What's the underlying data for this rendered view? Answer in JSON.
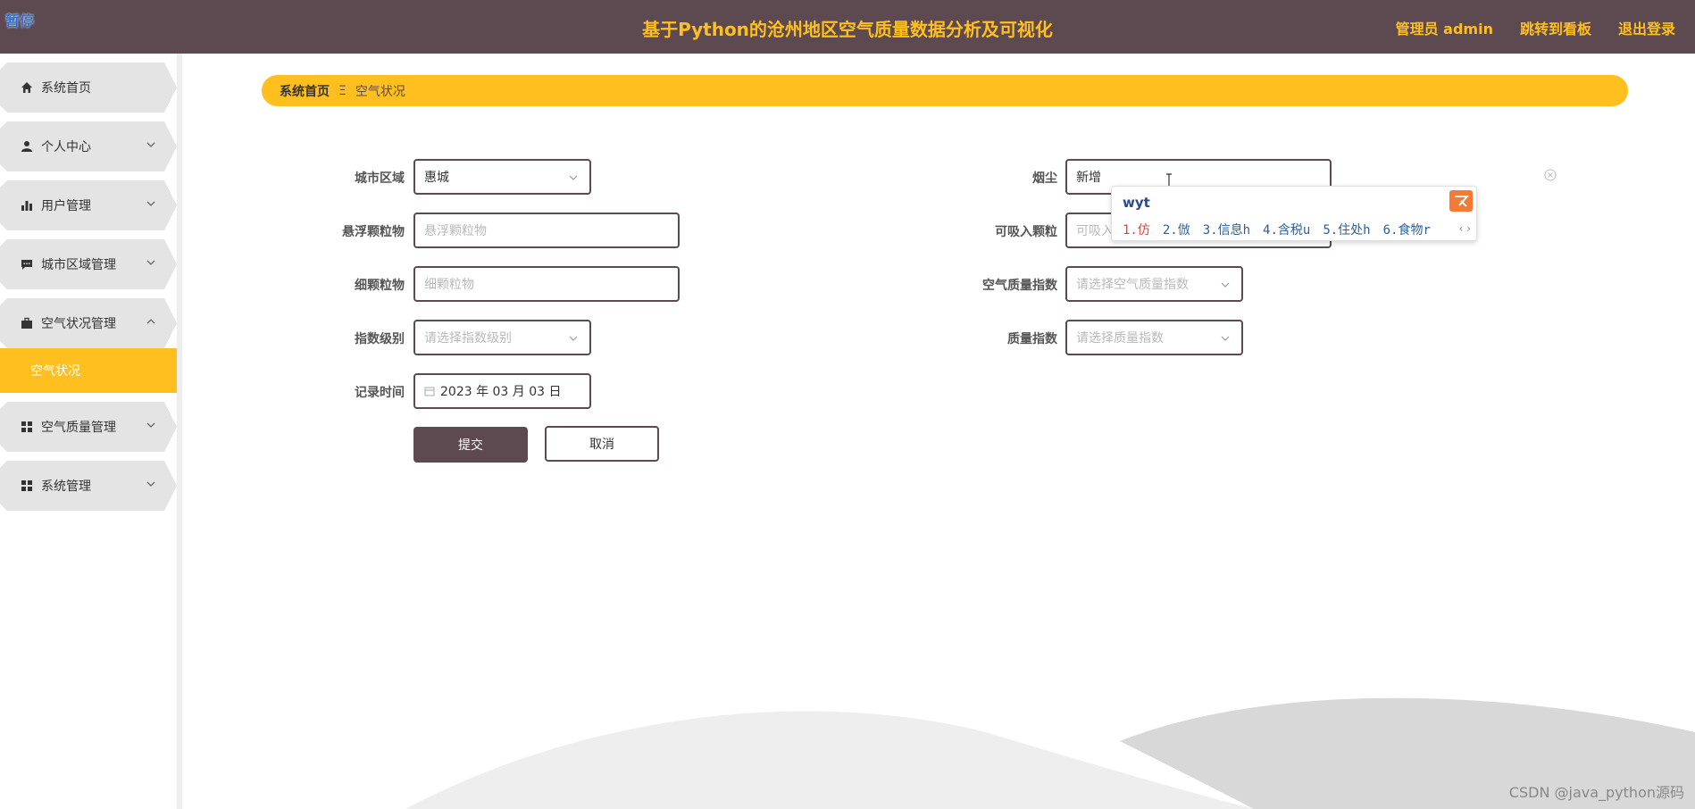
{
  "header": {
    "pause_label": "暂停",
    "title": "基于Python的沧州地区空气质量数据分析及可视化",
    "links": [
      "管理员 admin",
      "跳转到看板",
      "退出登录"
    ]
  },
  "sidebar": {
    "items": [
      {
        "label": "系统首页",
        "icon": "home-icon"
      },
      {
        "label": "个人中心",
        "icon": "user-icon"
      },
      {
        "label": "用户管理",
        "icon": "bar-chart-icon"
      },
      {
        "label": "城市区域管理",
        "icon": "chat-icon"
      },
      {
        "label": "空气状况管理",
        "icon": "briefcase-icon"
      },
      {
        "label": "空气质量管理",
        "icon": "grid-icon"
      },
      {
        "label": "系统管理",
        "icon": "grid-icon"
      }
    ],
    "active_sub": "空气状况"
  },
  "breadcrumb": {
    "home": "系统首页",
    "separator": "Ξ",
    "current": "空气状况"
  },
  "form": {
    "city_label": "城市区域",
    "city_value": "惠城",
    "dust_label": "烟尘",
    "dust_value": "新增",
    "tsp_label": "悬浮颗粒物",
    "tsp_placeholder": "悬浮颗粒物",
    "pm10_label": "可吸入颗粒",
    "pm10_placeholder": "可吸入",
    "pm25_label": "细颗粒物",
    "pm25_placeholder": "细颗粒物",
    "aqi_label": "空气质量指数",
    "aqi_placeholder": "请选择空气质量指数",
    "level_label": "指数级别",
    "level_placeholder": "请选择指数级别",
    "quality_label": "质量指数",
    "quality_placeholder": "请选择质量指数",
    "time_label": "记录时间",
    "time_value": "2023 年 03 月 03 日",
    "submit_label": "提交",
    "cancel_label": "取消"
  },
  "ime": {
    "typed": "wyt",
    "candidates": [
      "1.仿",
      "2.倣",
      "3.信息h",
      "4.含税u",
      "5.住处h",
      "6.食物r"
    ],
    "nav": "‹ ›"
  },
  "watermark": "CSDN @java_python源码",
  "colors": {
    "header_bg": "#5d4a51",
    "accent": "#ffbf1f",
    "border": "#5d4a51"
  }
}
